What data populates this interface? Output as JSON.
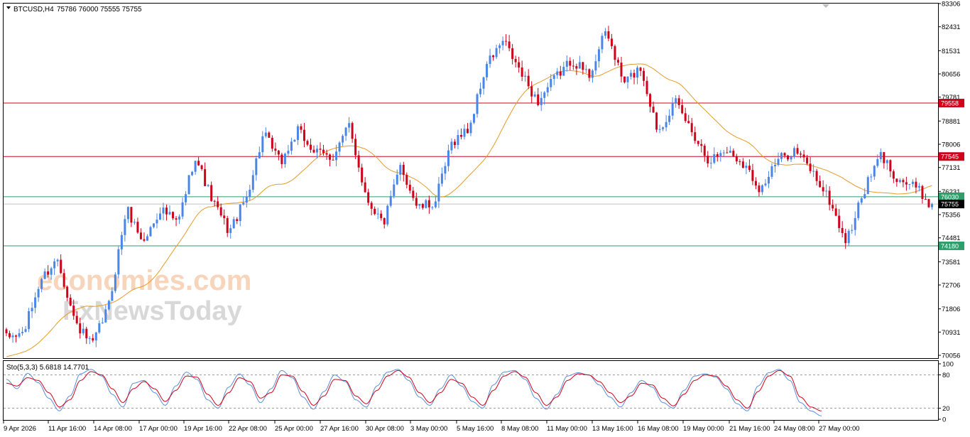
{
  "header": {
    "symbol_label": "BTCUSD,H4",
    "ohlc_label": "75786 76000 75555 75755"
  },
  "watermark": {
    "line1": "economies.com",
    "line2": "FxNewsToday"
  },
  "colors": {
    "bull": "#4a86e8",
    "bear": "#d0021b",
    "ma": "#e69b28",
    "resistance": "#d0021b",
    "support": "#2e9e6b",
    "stoch_main": "#5b8fd9",
    "stoch_signal": "#d0021b"
  },
  "chart_data": [
    {
      "type": "candlestick",
      "title": "BTCUSD,H4",
      "ylim": [
        69950,
        83306
      ],
      "y_ticks": [
        "83306",
        "82431",
        "81531",
        "80656",
        "79781",
        "78881",
        "78006",
        "77131",
        "76231",
        "75356",
        "74481",
        "73581",
        "72706",
        "71806",
        "70931",
        "70056"
      ],
      "x_ticks": [
        "9 Apr 2026",
        "11 Apr 16:00",
        "14 Apr 08:00",
        "17 Apr 00:00",
        "19 Apr 16:00",
        "22 Apr 08:00",
        "25 Apr 00:00",
        "27 Apr 16:00",
        "30 Apr 08:00",
        "3 May 00:00",
        "5 May 16:00",
        "8 May 08:00",
        "11 May 00:00",
        "13 May 16:00",
        "16 May 08:00",
        "19 May 00:00",
        "21 May 16:00",
        "24 May 08:00",
        "27 May 00:00"
      ],
      "last_close": "75755",
      "levels": [
        {
          "label": "79558",
          "value": 79558,
          "kind": "resistance"
        },
        {
          "label": "77545",
          "value": 77545,
          "kind": "resistance"
        },
        {
          "label": "76030",
          "value": 76030,
          "kind": "support"
        },
        {
          "label": "74180",
          "value": 74180,
          "kind": "support"
        }
      ],
      "price_anchors": [
        70700,
        70900,
        72900,
        73700,
        71300,
        70400,
        72000,
        75600,
        74300,
        75600,
        75000,
        77600,
        75900,
        74700,
        76000,
        78400,
        77300,
        78500,
        77700,
        77500,
        78700,
        76000,
        75000,
        77200,
        75600,
        75800,
        78100,
        78600,
        81000,
        81900,
        80700,
        79600,
        80500,
        81200,
        80600,
        82300,
        80300,
        80900,
        78500,
        79600,
        78500,
        77400,
        77800,
        77300,
        76300,
        77400,
        77800,
        77000,
        75900,
        74300,
        76200,
        77600,
        76700,
        76400,
        75700
      ],
      "moving_average": {
        "name": "",
        "start": 70000,
        "end": 76900,
        "peak": 80800
      },
      "grid": false
    },
    {
      "type": "line",
      "title": "Sto(5,3,3) 5.6818 14.7701",
      "ylim": [
        0,
        100
      ],
      "y_ticks": [
        "100",
        "80",
        "20",
        "0"
      ],
      "levels": [
        80,
        20
      ],
      "series": [
        {
          "name": "",
          "values": [
            72,
            55,
            83,
            66,
            38,
            15,
            42,
            82,
            90,
            78,
            45,
            22,
            65,
            70,
            48,
            25,
            60,
            85,
            72,
            35,
            20,
            58,
            82,
            62,
            30,
            55,
            88,
            75,
            40,
            18,
            50,
            80,
            68,
            35,
            22,
            60,
            85,
            90,
            70,
            40,
            25,
            55,
            80,
            60,
            32,
            20,
            62,
            85,
            88,
            72,
            38,
            18,
            45,
            78,
            84,
            80,
            62,
            40,
            22,
            48,
            70,
            58,
            30,
            20,
            52,
            78,
            82,
            76,
            55,
            28,
            15,
            60,
            84,
            90,
            70,
            30,
            15,
            6
          ]
        },
        {
          "name": "",
          "values": [
            65,
            60,
            75,
            70,
            48,
            22,
            35,
            70,
            86,
            80,
            55,
            30,
            55,
            68,
            55,
            32,
            52,
            78,
            76,
            45,
            25,
            48,
            75,
            68,
            38,
            48,
            80,
            78,
            50,
            25,
            42,
            72,
            70,
            42,
            28,
            52,
            78,
            88,
            76,
            48,
            30,
            48,
            72,
            65,
            40,
            25,
            52,
            78,
            86,
            76,
            48,
            25,
            40,
            70,
            82,
            80,
            68,
            48,
            30,
            42,
            65,
            62,
            38,
            24,
            45,
            70,
            80,
            78,
            60,
            35,
            20,
            50,
            78,
            88,
            78,
            40,
            22,
            15
          ]
        }
      ]
    }
  ]
}
